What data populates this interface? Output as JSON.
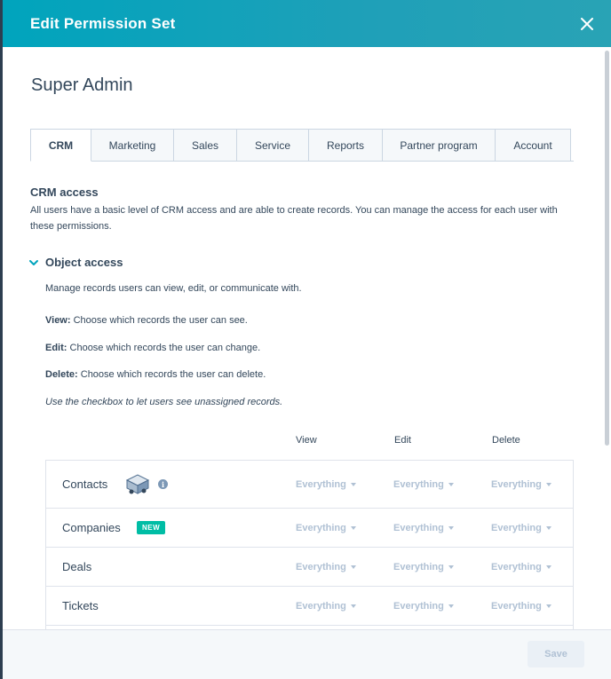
{
  "header": {
    "title": "Edit Permission Set"
  },
  "permission_set": {
    "name": "Super Admin"
  },
  "tabs": [
    {
      "label": "CRM",
      "active": true
    },
    {
      "label": "Marketing"
    },
    {
      "label": "Sales"
    },
    {
      "label": "Service"
    },
    {
      "label": "Reports"
    },
    {
      "label": "Partner program"
    },
    {
      "label": "Account"
    }
  ],
  "crm_access": {
    "title": "CRM access",
    "description": "All users have a basic level of CRM access and are able to create records. You can manage the access for each user with these permissions."
  },
  "object_access": {
    "title": "Object access",
    "intro": "Manage records users can view, edit, or communicate with.",
    "view_label": "View:",
    "view_text": " Choose which records the user can see.",
    "edit_label": "Edit:",
    "edit_text": " Choose which records the user can change.",
    "delete_label": "Delete:",
    "delete_text": " Choose which records the user can delete.",
    "checkbox_note": "Use the checkbox to let users see unassigned records."
  },
  "columns": {
    "view": "View",
    "edit": "Edit",
    "delete": "Delete"
  },
  "rows": [
    {
      "label": "Contacts",
      "view": "Everything",
      "edit": "Everything",
      "delete": "Everything"
    },
    {
      "label": "Companies",
      "badge": "NEW",
      "view": "Everything",
      "edit": "Everything",
      "delete": "Everything"
    },
    {
      "label": "Deals",
      "view": "Everything",
      "edit": "Everything",
      "delete": "Everything"
    },
    {
      "label": "Tickets",
      "view": "Everything",
      "edit": "Everything",
      "delete": "Everything"
    }
  ],
  "footer": {
    "save_label": "Save"
  },
  "colors": {
    "header": "#00a4bd",
    "badge": "#00bda5",
    "text": "#33475b",
    "muted": "#b0c1d4"
  }
}
